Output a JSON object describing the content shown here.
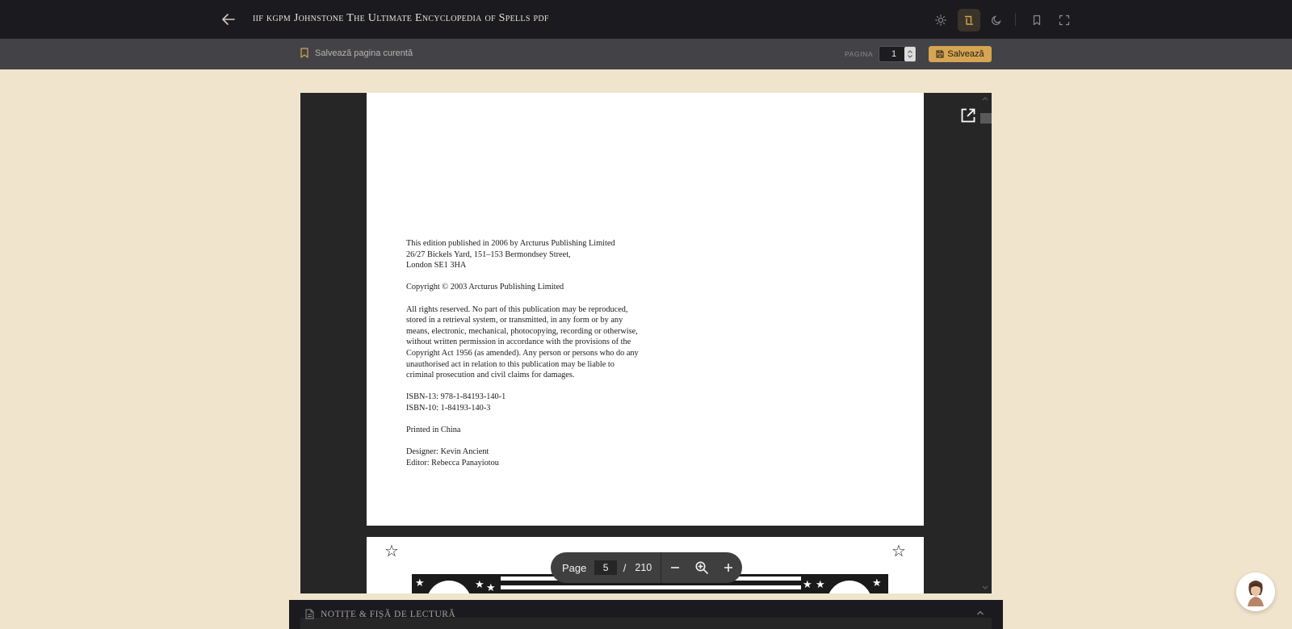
{
  "header": {
    "title": "iif kgpm Johnstone The Ultimate Encyclopedia of Spells pdf",
    "icons": [
      "arrow-left-icon",
      "sun-icon",
      "sepia-mode-icon",
      "moon-icon",
      "bookmark-icon",
      "fullscreen-icon"
    ]
  },
  "savebar": {
    "save_current_label": "Salvează pagina curentă",
    "page_label": "PAGINA",
    "page_value": "1",
    "save_button_label": "Salvează"
  },
  "document": {
    "paragraphs": [
      "This edition published in 2006 by Arcturus Publishing Limited\n26/27 Bickels Yard, 151–153 Bermondsey Street,\nLondon SE1 3HA",
      "Copyright © 2003 Arcturus Publishing Limited",
      "All rights reserved. No part of this publication may be reproduced,\nstored in a retrieval system, or transmitted, in any form or by any\nmeans, electronic, mechanical, photocopying, recording or otherwise,\nwithout written permission in accordance with the provisions of the\nCopyright Act 1956 (as amended). Any person or persons who do any\nunauthorised act in relation to this publication may be liable to\ncriminal prosecution and civil claims for damages.",
      "ISBN-13: 978-1-84193-140-1\nISBN-10: 1-84193-140-3",
      "Printed in China",
      "Designer: Kevin Ancient\nEditor: Rebecca Panayiotou"
    ]
  },
  "zoom_toolbar": {
    "page_label": "Page",
    "current_page": "5",
    "separator": "/",
    "total_pages": "210"
  },
  "notes": {
    "label": "NOTIȚE & FIȘĂ DE LECTURĂ"
  },
  "colors": {
    "accent": "#d6a551",
    "background": "#f0e4cd",
    "topbar": "#1b1b1f",
    "savebar": "#434347"
  }
}
